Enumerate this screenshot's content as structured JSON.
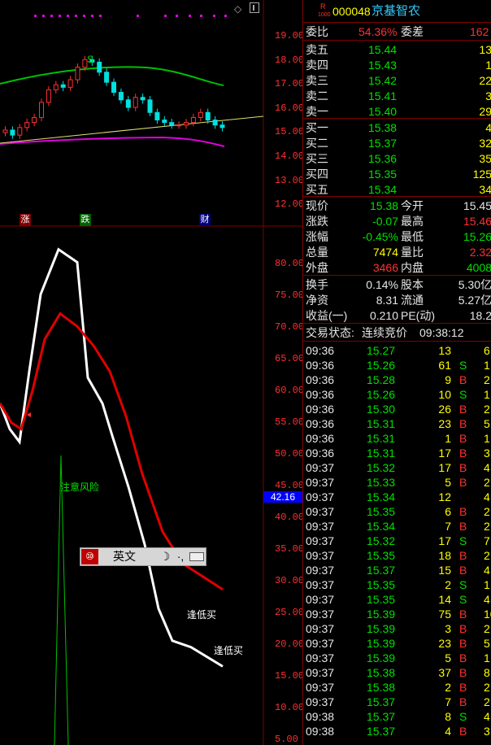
{
  "stock": {
    "code": "000048",
    "name": "京基智农",
    "badge": "R",
    "badge_sub": "1000"
  },
  "upper_axis": [
    "19.00",
    "18.00",
    "17.00",
    "16.00",
    "15.00",
    "14.00",
    "13.00",
    "12.00"
  ],
  "lower_axis": [
    "80.00",
    "75.00",
    "70.00",
    "65.00",
    "60.00",
    "55.00",
    "50.00",
    "45.00",
    "40.00",
    "35.00",
    "30.00",
    "25.00",
    "20.00",
    "15.00",
    "10.00",
    "5.00"
  ],
  "current_marker": "42.16",
  "chart_markers": {
    "s_label": "S",
    "zhang": "涨",
    "die": "跌",
    "cai": "财"
  },
  "annotations": {
    "risk": "注意风险",
    "buy1": "逢低买",
    "buy2": "逢低买"
  },
  "ime": {
    "mode": "英文"
  },
  "colors": {
    "up": "#ff3030",
    "down": "#00e000",
    "grid": "#800000",
    "accent_blue": "#0000ff"
  },
  "chart_data": {
    "type": "line",
    "upper_price_candles": {
      "ylim": [
        12,
        19.5
      ],
      "approx_closes": [
        15.3,
        15.1,
        15.4,
        15.6,
        15.8,
        16.4,
        16.9,
        17.1,
        17.0,
        17.3,
        17.8,
        18.1,
        18.0,
        17.6,
        17.2,
        16.8,
        16.5,
        16.2,
        16.6,
        16.5,
        16.0,
        15.7,
        15.6,
        15.5,
        15.5,
        15.6,
        15.8,
        16.0,
        15.7,
        15.5,
        15.4
      ]
    },
    "lower_indicator": {
      "ylim": [
        5,
        85
      ],
      "series": [
        {
          "color": "white",
          "values": [
            58,
            54,
            52,
            63,
            75,
            82,
            80,
            62,
            58,
            53,
            45,
            36,
            26,
            21,
            20,
            17
          ]
        },
        {
          "color": "red",
          "values": [
            58,
            55,
            54,
            60,
            68,
            72,
            70,
            67,
            63,
            56,
            47,
            38,
            33,
            29
          ]
        }
      ]
    }
  },
  "panel": {
    "weibi": {
      "label": "委比",
      "value": "54.36%",
      "label2": "委差",
      "value2": "162"
    },
    "sells": [
      {
        "label": "卖五",
        "price": "15.44",
        "vol": "13"
      },
      {
        "label": "卖四",
        "price": "15.43",
        "vol": "1"
      },
      {
        "label": "卖三",
        "price": "15.42",
        "vol": "22"
      },
      {
        "label": "卖二",
        "price": "15.41",
        "vol": "3"
      },
      {
        "label": "卖一",
        "price": "15.40",
        "vol": "29"
      }
    ],
    "buys": [
      {
        "label": "买一",
        "price": "15.38",
        "vol": "4"
      },
      {
        "label": "买二",
        "price": "15.37",
        "vol": "32"
      },
      {
        "label": "买三",
        "price": "15.36",
        "vol": "35"
      },
      {
        "label": "买四",
        "price": "15.35",
        "vol": "125"
      },
      {
        "label": "买五",
        "price": "15.34",
        "vol": "34"
      }
    ],
    "quote": [
      {
        "l1": "现价",
        "v1": "15.38",
        "c1": "green",
        "l2": "今开",
        "v2": "15.45",
        "c2": "white"
      },
      {
        "l1": "涨跌",
        "v1": "-0.07",
        "c1": "green",
        "l2": "最高",
        "v2": "15.46",
        "c2": "red"
      },
      {
        "l1": "涨幅",
        "v1": "-0.45%",
        "c1": "green",
        "l2": "最低",
        "v2": "15.26",
        "c2": "green"
      },
      {
        "l1": "总量",
        "v1": "7474",
        "c1": "yellow",
        "l2": "量比",
        "v2": "2.32",
        "c2": "red"
      },
      {
        "l1": "外盘",
        "v1": "3466",
        "c1": "red",
        "l2": "内盘",
        "v2": "4008",
        "c2": "green"
      }
    ],
    "finance": [
      {
        "l1": "换手",
        "v1": "0.14%",
        "l2": "股本",
        "v2": "5.30亿"
      },
      {
        "l1": "净资",
        "v1": "8.31",
        "l2": "流通",
        "v2": "5.27亿"
      },
      {
        "l1": "收益(一)",
        "v1": "0.210",
        "l2": "PE(动)",
        "v2": "18.2"
      }
    ],
    "status": {
      "label": "交易状态:",
      "value": "连续竞价",
      "time": "09:38:12"
    },
    "ticks": [
      {
        "t": "09:36",
        "p": "15.27",
        "v": "13",
        "s": "",
        "n": "6"
      },
      {
        "t": "09:36",
        "p": "15.26",
        "v": "61",
        "s": "S",
        "n": "1"
      },
      {
        "t": "09:36",
        "p": "15.28",
        "v": "9",
        "s": "B",
        "n": "2"
      },
      {
        "t": "09:36",
        "p": "15.26",
        "v": "10",
        "s": "S",
        "n": "1"
      },
      {
        "t": "09:36",
        "p": "15.30",
        "v": "26",
        "s": "B",
        "n": "2"
      },
      {
        "t": "09:36",
        "p": "15.31",
        "v": "23",
        "s": "B",
        "n": "5"
      },
      {
        "t": "09:36",
        "p": "15.31",
        "v": "1",
        "s": "B",
        "n": "1"
      },
      {
        "t": "09:36",
        "p": "15.31",
        "v": "17",
        "s": "B",
        "n": "3"
      },
      {
        "t": "09:37",
        "p": "15.32",
        "v": "17",
        "s": "B",
        "n": "4"
      },
      {
        "t": "09:37",
        "p": "15.33",
        "v": "5",
        "s": "B",
        "n": "2"
      },
      {
        "t": "09:37",
        "p": "15.34",
        "v": "12",
        "s": "",
        "n": "4"
      },
      {
        "t": "09:37",
        "p": "15.35",
        "v": "6",
        "s": "B",
        "n": "2"
      },
      {
        "t": "09:37",
        "p": "15.34",
        "v": "7",
        "s": "B",
        "n": "2"
      },
      {
        "t": "09:37",
        "p": "15.32",
        "v": "17",
        "s": "S",
        "n": "7"
      },
      {
        "t": "09:37",
        "p": "15.35",
        "v": "18",
        "s": "B",
        "n": "2"
      },
      {
        "t": "09:37",
        "p": "15.37",
        "v": "15",
        "s": "B",
        "n": "4"
      },
      {
        "t": "09:37",
        "p": "15.35",
        "v": "2",
        "s": "S",
        "n": "1"
      },
      {
        "t": "09:37",
        "p": "15.35",
        "v": "14",
        "s": "S",
        "n": "4"
      },
      {
        "t": "09:37",
        "p": "15.39",
        "v": "75",
        "s": "B",
        "n": "10"
      },
      {
        "t": "09:37",
        "p": "15.39",
        "v": "3",
        "s": "B",
        "n": "2"
      },
      {
        "t": "09:37",
        "p": "15.39",
        "v": "23",
        "s": "B",
        "n": "5"
      },
      {
        "t": "09:37",
        "p": "15.39",
        "v": "5",
        "s": "B",
        "n": "1"
      },
      {
        "t": "09:37",
        "p": "15.38",
        "v": "37",
        "s": "B",
        "n": "8"
      },
      {
        "t": "09:37",
        "p": "15.38",
        "v": "2",
        "s": "B",
        "n": "2"
      },
      {
        "t": "09:37",
        "p": "15.37",
        "v": "7",
        "s": "B",
        "n": "2"
      },
      {
        "t": "09:38",
        "p": "15.37",
        "v": "8",
        "s": "S",
        "n": "4"
      },
      {
        "t": "09:38",
        "p": "15.37",
        "v": "4",
        "s": "B",
        "n": "3"
      }
    ]
  }
}
